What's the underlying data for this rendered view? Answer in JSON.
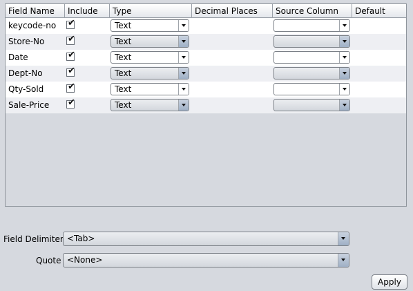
{
  "table": {
    "columns": [
      "Field Name",
      "Include",
      "Type",
      "Decimal Places",
      "Source Column",
      "Default"
    ],
    "rows": [
      {
        "field_name": "keycode-no",
        "include": true,
        "type": "Text",
        "type_enabled": true,
        "source_column": "",
        "source_enabled": true
      },
      {
        "field_name": "Store-No",
        "include": true,
        "type": "Text",
        "type_enabled": false,
        "source_column": "",
        "source_enabled": false
      },
      {
        "field_name": "Date",
        "include": true,
        "type": "Text",
        "type_enabled": true,
        "source_column": "",
        "source_enabled": true
      },
      {
        "field_name": "Dept-No",
        "include": true,
        "type": "Text",
        "type_enabled": false,
        "source_column": "",
        "source_enabled": false
      },
      {
        "field_name": "Qty-Sold",
        "include": true,
        "type": "Text",
        "type_enabled": true,
        "source_column": "",
        "source_enabled": true
      },
      {
        "field_name": "Sale-Price",
        "include": true,
        "type": "Text",
        "type_enabled": false,
        "source_column": "",
        "source_enabled": false
      }
    ]
  },
  "options": {
    "field_delimiter_label": "Field Delimiter",
    "field_delimiter_value": "<Tab>",
    "quote_label": "Quote",
    "quote_value": "<None>"
  },
  "buttons": {
    "apply": "Apply"
  },
  "icons": {
    "checkbox_checked": "check-icon",
    "dropdown": "chevron-down-icon"
  }
}
